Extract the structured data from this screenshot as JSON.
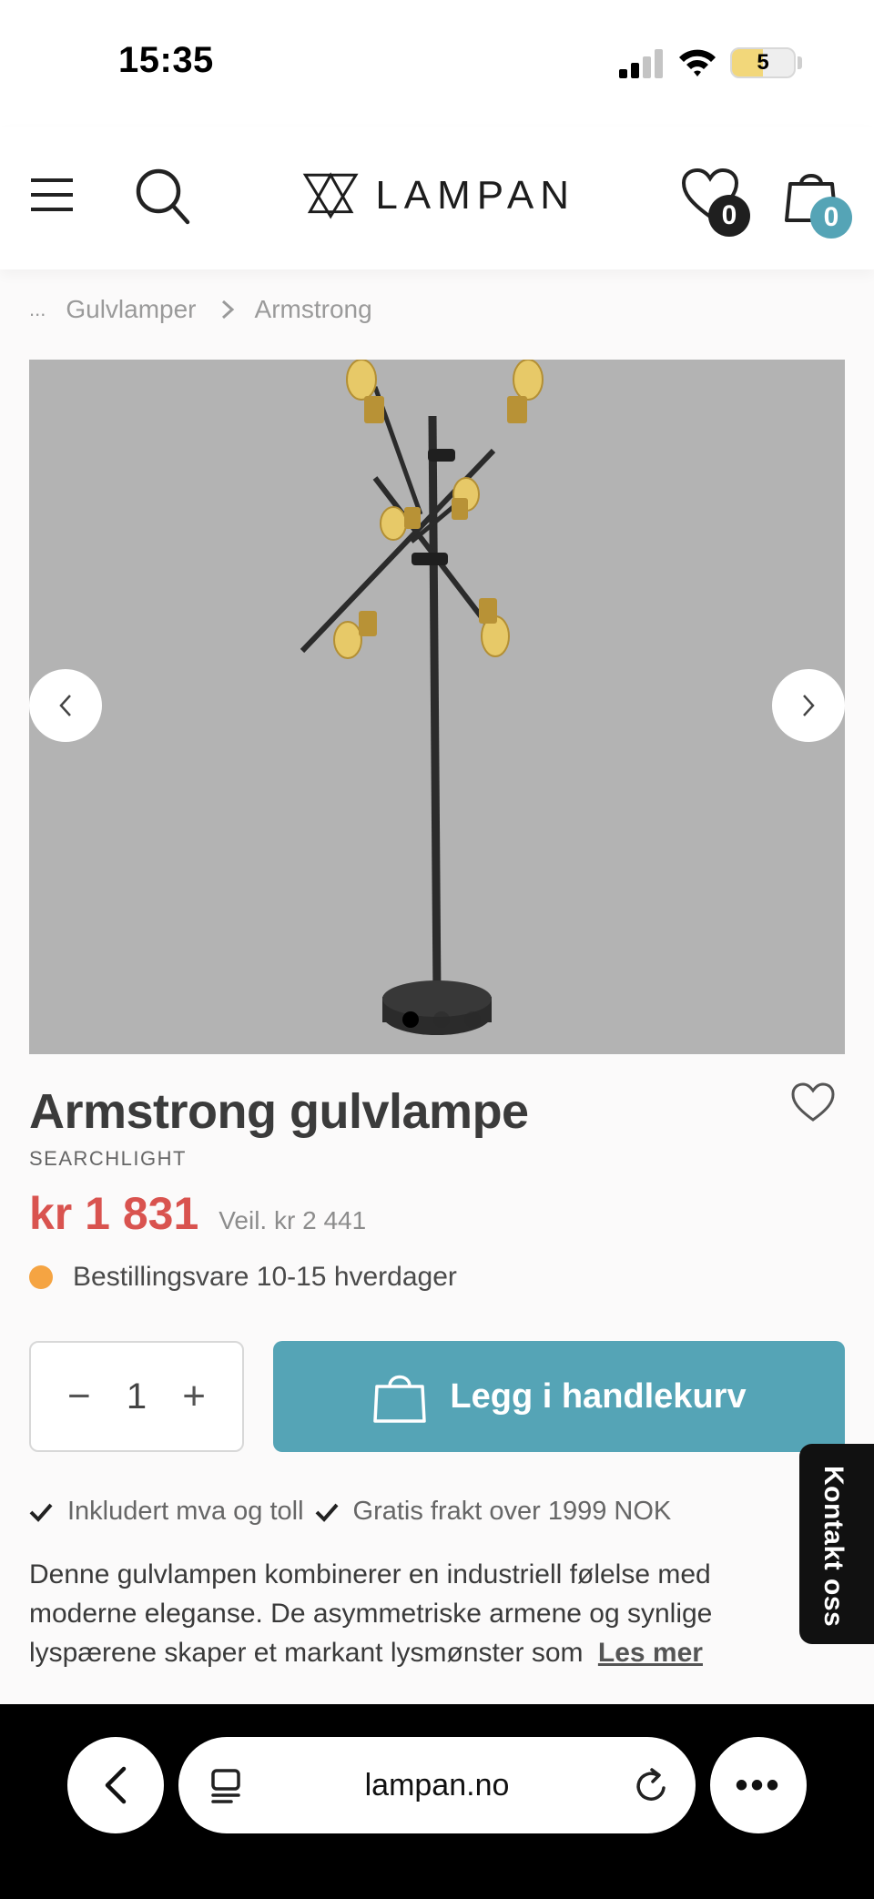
{
  "status_bar": {
    "time": "15:35",
    "battery_level": "5",
    "battery_fraction": 0.5
  },
  "header": {
    "logo_text": "LAMPAN",
    "wishlist_count": "0",
    "cart_count": "0"
  },
  "breadcrumb": {
    "ellipsis": "...",
    "items": [
      "Gulvlamper",
      "Armstrong"
    ]
  },
  "gallery": {
    "slide_count": 3,
    "active_slide": 1
  },
  "product": {
    "title": "Armstrong gulvlampe",
    "brand": "SEARCHLIGHT",
    "price": "kr 1 831",
    "recommended_price": "Veil. kr 2 441",
    "stock_text": "Bestillingsvare 10-15 hverdager",
    "stock_color": "#f5a442",
    "quantity": "1",
    "add_to_cart_label": "Legg i handlekurv",
    "usps": [
      "Inkludert mva og toll",
      "Gratis frakt over 1999 NOK"
    ],
    "description": "Denne gulvlampen kombinerer en industriell følelse med moderne eleganse. De asymmetriske armene og synlige lyspærene skaper et markant lysmønster som",
    "read_more": "Les mer"
  },
  "contact_tab": {
    "label": "Kontakt oss"
  },
  "browser": {
    "domain": "lampan.no",
    "more": "•••"
  },
  "colors": {
    "accent": "#55a4b6",
    "price": "#d9534f",
    "image_bg": "#b3b3b3"
  }
}
